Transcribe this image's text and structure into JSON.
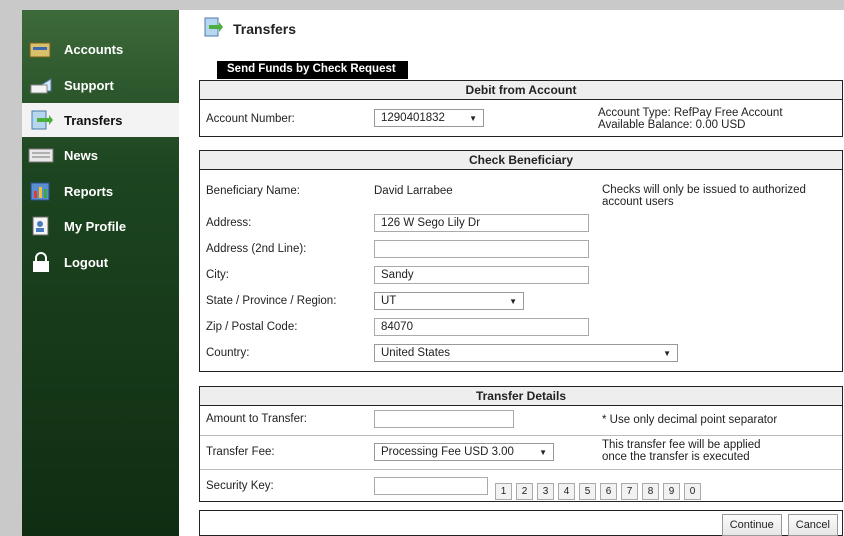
{
  "sidebar": {
    "items": [
      {
        "label": "Accounts",
        "icon": "accounts-icon"
      },
      {
        "label": "Support",
        "icon": "support-icon"
      },
      {
        "label": "Transfers",
        "icon": "transfers-icon"
      },
      {
        "label": "News",
        "icon": "news-icon"
      },
      {
        "label": "Reports",
        "icon": "reports-icon"
      },
      {
        "label": "My Profile",
        "icon": "profile-icon"
      },
      {
        "label": "Logout",
        "icon": "lock-icon"
      }
    ]
  },
  "header": {
    "title": "Transfers"
  },
  "tab": {
    "label": "Send Funds by Check Request"
  },
  "debit": {
    "heading": "Debit from Account",
    "account_label": "Account Number:",
    "account_value": "1290401832",
    "account_type": "Account Type: RefPay Free Account",
    "balance": "Available Balance: 0.00 USD"
  },
  "beneficiary": {
    "heading": "Check Beneficiary",
    "name_label": "Beneficiary Name:",
    "name_value": "David Larrabee",
    "note": "Checks will only be issued to authorized account users",
    "address_label": "Address:",
    "address_value": "126 W Sego Lily Dr",
    "address2_label": "Address (2nd Line):",
    "address2_value": "",
    "city_label": "City:",
    "city_value": "Sandy",
    "state_label": "State / Province / Region:",
    "state_value": "UT",
    "zip_label": "Zip / Postal Code:",
    "zip_value": "84070",
    "country_label": "Country:",
    "country_value": "United States"
  },
  "transfer": {
    "heading": "Transfer Details",
    "amount_label": "Amount to Transfer:",
    "amount_value": "",
    "amount_note": "* Use only decimal point separator",
    "fee_label": "Transfer Fee:",
    "fee_value": "Processing Fee USD 3.00",
    "fee_note_1": "This transfer fee will be applied",
    "fee_note_2": "once the transfer is executed",
    "security_label": "Security Key:",
    "security_value": "",
    "keys": [
      "1",
      "2",
      "3",
      "4",
      "5",
      "6",
      "7",
      "8",
      "9",
      "0"
    ]
  },
  "actions": {
    "continue": "Continue",
    "cancel": "Cancel"
  }
}
